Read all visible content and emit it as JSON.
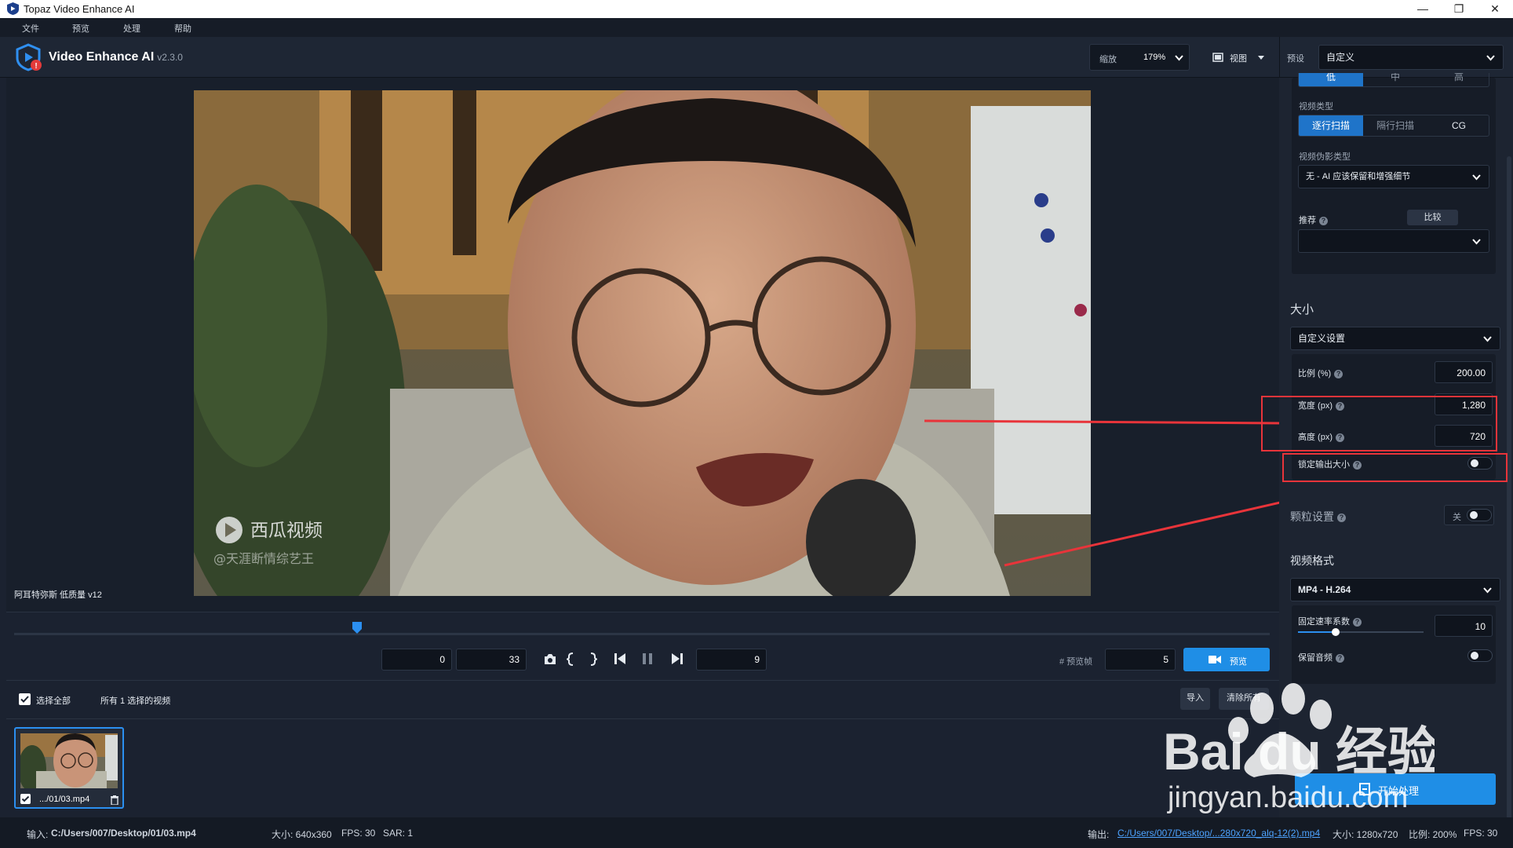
{
  "window": {
    "title": "Topaz Video Enhance AI",
    "minimize": "—",
    "maximize": "❐",
    "close": "✕"
  },
  "menu": [
    "文件",
    "预览",
    "处理",
    "帮助"
  ],
  "header": {
    "app_name": "Video Enhance AI",
    "version": "v2.3.0",
    "zoom_label": "缩放",
    "zoom_value": "179%",
    "view_label": "视图",
    "preset_label": "预设",
    "preset_value": "自定义"
  },
  "video": {
    "watermark_logo": "西瓜视频",
    "watermark_handle": "@天涯断情综艺王",
    "model_label": "阿耳特弥斯 低质量 v12"
  },
  "timeline": {
    "start": "0",
    "end": "33",
    "current": "9",
    "preview_frames_label": "# 预览帧",
    "preview_frames": "5",
    "preview_button": "预览"
  },
  "filelist": {
    "select_all": "选择全部",
    "count_text": "所有 1 选择的视频",
    "import": "导入",
    "clear_all": "清除所有",
    "items": [
      {
        "name": ".../01/03.mp4"
      }
    ]
  },
  "sidebar": {
    "top_seg": [
      "低",
      "中",
      "高"
    ],
    "video_type_label": "视频类型",
    "video_type_options": [
      "逐行扫描",
      "隔行扫描",
      "CG"
    ],
    "artifact_label": "视频伪影类型",
    "artifact_value": "无 - AI 应该保留和增强细节",
    "recommend_label": "推荐",
    "compare_button": "比较",
    "recommend_value": "",
    "size_title": "大小",
    "size_mode": "自定义设置",
    "scale_label": "比例 (%)",
    "scale_value": "200.00",
    "width_label": "宽度 (px)",
    "width_value": "1,280",
    "height_label": "高度 (px)",
    "height_value": "720",
    "lock_label": "锁定输出大小",
    "lock_on": false,
    "grain_label": "颗粒设置",
    "grain_state": "关",
    "format_title": "视频格式",
    "format_value": "MP4 - H.264",
    "crf_label": "固定速率系数",
    "crf_value": "10",
    "crf_fraction": 0.3,
    "audio_label": "保留音频",
    "start_button": "开始处理"
  },
  "status": {
    "input_label": "输入:",
    "input_path": "C:/Users/007/Desktop/01/03.mp4",
    "input_size": "大小: 640x360",
    "input_fps": "FPS: 30",
    "input_sar": "SAR: 1",
    "output_label": "输出:",
    "output_path": "C:/Users/007/Desktop/...280x720_alq-12(2).mp4",
    "output_size": "大小: 1280x720",
    "output_ratio": "比例: 200%",
    "output_fps": "FPS: 30"
  },
  "brand_watermark": {
    "text": "Bai du 经验",
    "url": "jingyan.baidu.com"
  },
  "colors": {
    "accent": "#1f8ee6",
    "annotation": "#e8343a",
    "bg": "#1b2230",
    "panel": "#161c27"
  }
}
